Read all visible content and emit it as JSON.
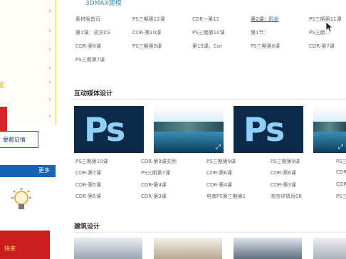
{
  "sidebar": {
    "box_label": "要都证情",
    "blue_bar_label": "更多",
    "promo_label": "快来",
    "highlight_dot": "止"
  },
  "top_section": {
    "title": "3DMAX建模",
    "links": [
      [
        "素材版首页",
        "PS三期第12课",
        "CDR一第11",
        "第2课：形状",
        "PS三期第11课"
      ],
      [
        "第1课：初识CS",
        "CDR-第10课",
        "PS三期第10课",
        "第1节：",
        "PS三期…"
      ],
      [
        "CDR-第9课",
        "PS三期第9课",
        "第15课，Cor",
        "PS三期第8课",
        "CDR-第7课"
      ],
      [
        "PS三期第7课"
      ]
    ]
  },
  "interactive_section": {
    "title": "互动媒体设计",
    "thumbs": [
      "ps",
      "sea",
      "ps",
      "sea"
    ],
    "ps_glyph": "Ps",
    "links": [
      [
        "PS三期第10课",
        "CDR-第9课实例",
        "PS三期第9课",
        "PS三期第9课",
        "PS三"
      ],
      [
        "CDR-第7课",
        "PS三期第7课",
        "CDR-第6课",
        "CDR-第6课",
        "CDR"
      ],
      [
        "CDR-第5课",
        "CDR-第4课",
        "CDR-第4课",
        "CDR-第3课",
        "CDR"
      ],
      [
        "CDR-第5课",
        "CDR-第3课",
        "电商PS第三期第1",
        "淘宝详情页06",
        "PS三"
      ]
    ]
  },
  "architecture_section": {
    "title": "建筑设计"
  }
}
